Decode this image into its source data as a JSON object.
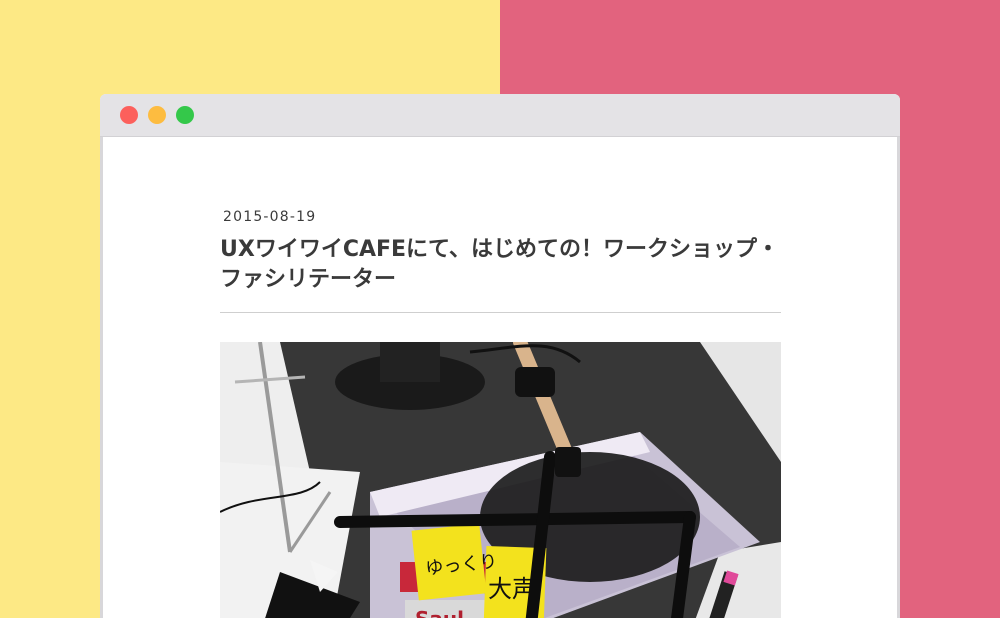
{
  "colors": {
    "bg_left": "#fde985",
    "bg_right": "#e2637e",
    "dot_close": "#fc605c",
    "dot_minimize": "#fdbc40",
    "dot_zoom": "#34c84a"
  },
  "window": {
    "controls": [
      "close",
      "minimize",
      "zoom"
    ]
  },
  "post": {
    "date": "2015-08-19",
    "title": "UXワイワイCAFEにて、はじめての！ワークショップ・ファシリテーター"
  },
  "photo": {
    "notes": {
      "left": "ゆっくり",
      "right": "大声"
    },
    "book_spine": "Saul"
  }
}
